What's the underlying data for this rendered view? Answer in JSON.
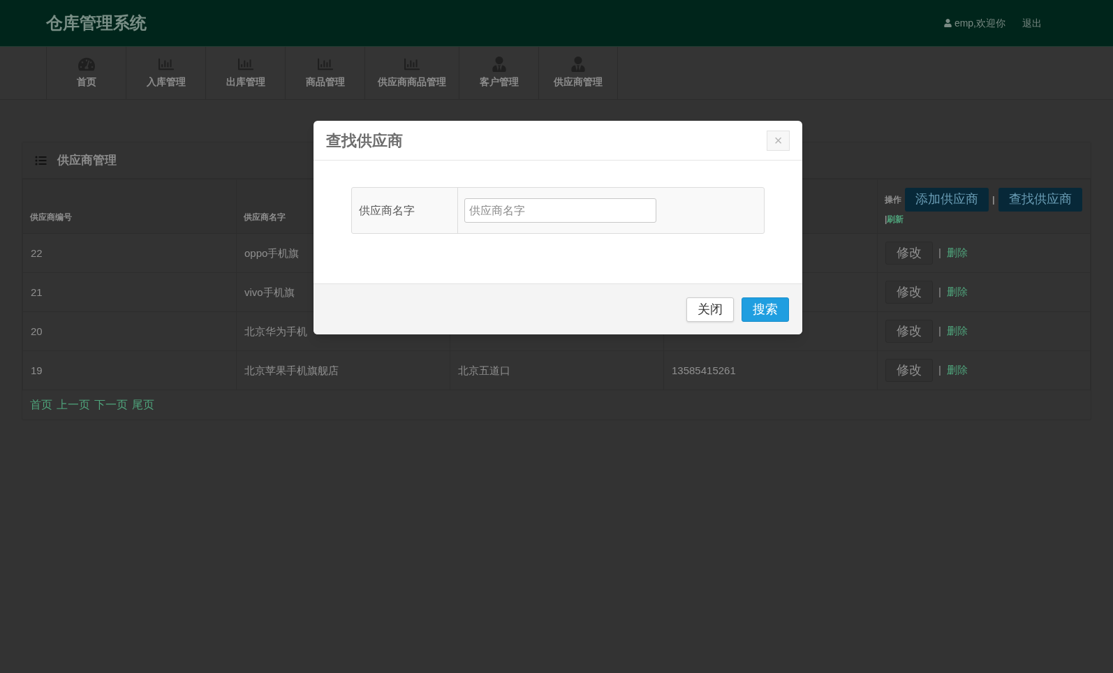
{
  "header": {
    "title": "仓库管理系统",
    "user": "emp,欢迎你",
    "logout": "退出"
  },
  "nav": [
    {
      "label": "首页"
    },
    {
      "label": "入库管理"
    },
    {
      "label": "出库管理"
    },
    {
      "label": "商品管理"
    },
    {
      "label": "供应商商品管理"
    },
    {
      "label": "客户管理"
    },
    {
      "label": "供应商管理"
    }
  ],
  "panel": {
    "title": "供应商管理",
    "columns": [
      "供应商编号",
      "供应商名字"
    ],
    "actions_header": {
      "label": "操作",
      "buttons": [
        "添加供应商",
        "查找供应商"
      ],
      "separator": "|",
      "refresh_separator": "|",
      "refresh": "刷新"
    },
    "rows": [
      {
        "id": "22",
        "name": "oppo手机旗",
        "edit": "修改",
        "separator": "|",
        "delete": "删除"
      },
      {
        "id": "21",
        "name": "vivo手机旗",
        "edit": "修改",
        "separator": "|",
        "delete": "删除"
      },
      {
        "id": "20",
        "name": "北京华为手机",
        "edit": "修改",
        "separator": "|",
        "delete": "删除"
      },
      {
        "id": "19",
        "name": "北京苹果手机旗舰店",
        "address": "北京五道口",
        "phone": "13585415261",
        "edit": "修改",
        "separator": "|",
        "delete": "删除"
      }
    ],
    "pagination": [
      "首页",
      "上一页",
      "下一页",
      "尾页"
    ]
  },
  "modal": {
    "title": "查找供应商",
    "close": "×",
    "field_label": "供应商名字",
    "placeholder": "供应商名字",
    "buttons": [
      {
        "label": "关闭",
        "kind": "default"
      },
      {
        "label": "搜索",
        "kind": "primary"
      }
    ]
  }
}
